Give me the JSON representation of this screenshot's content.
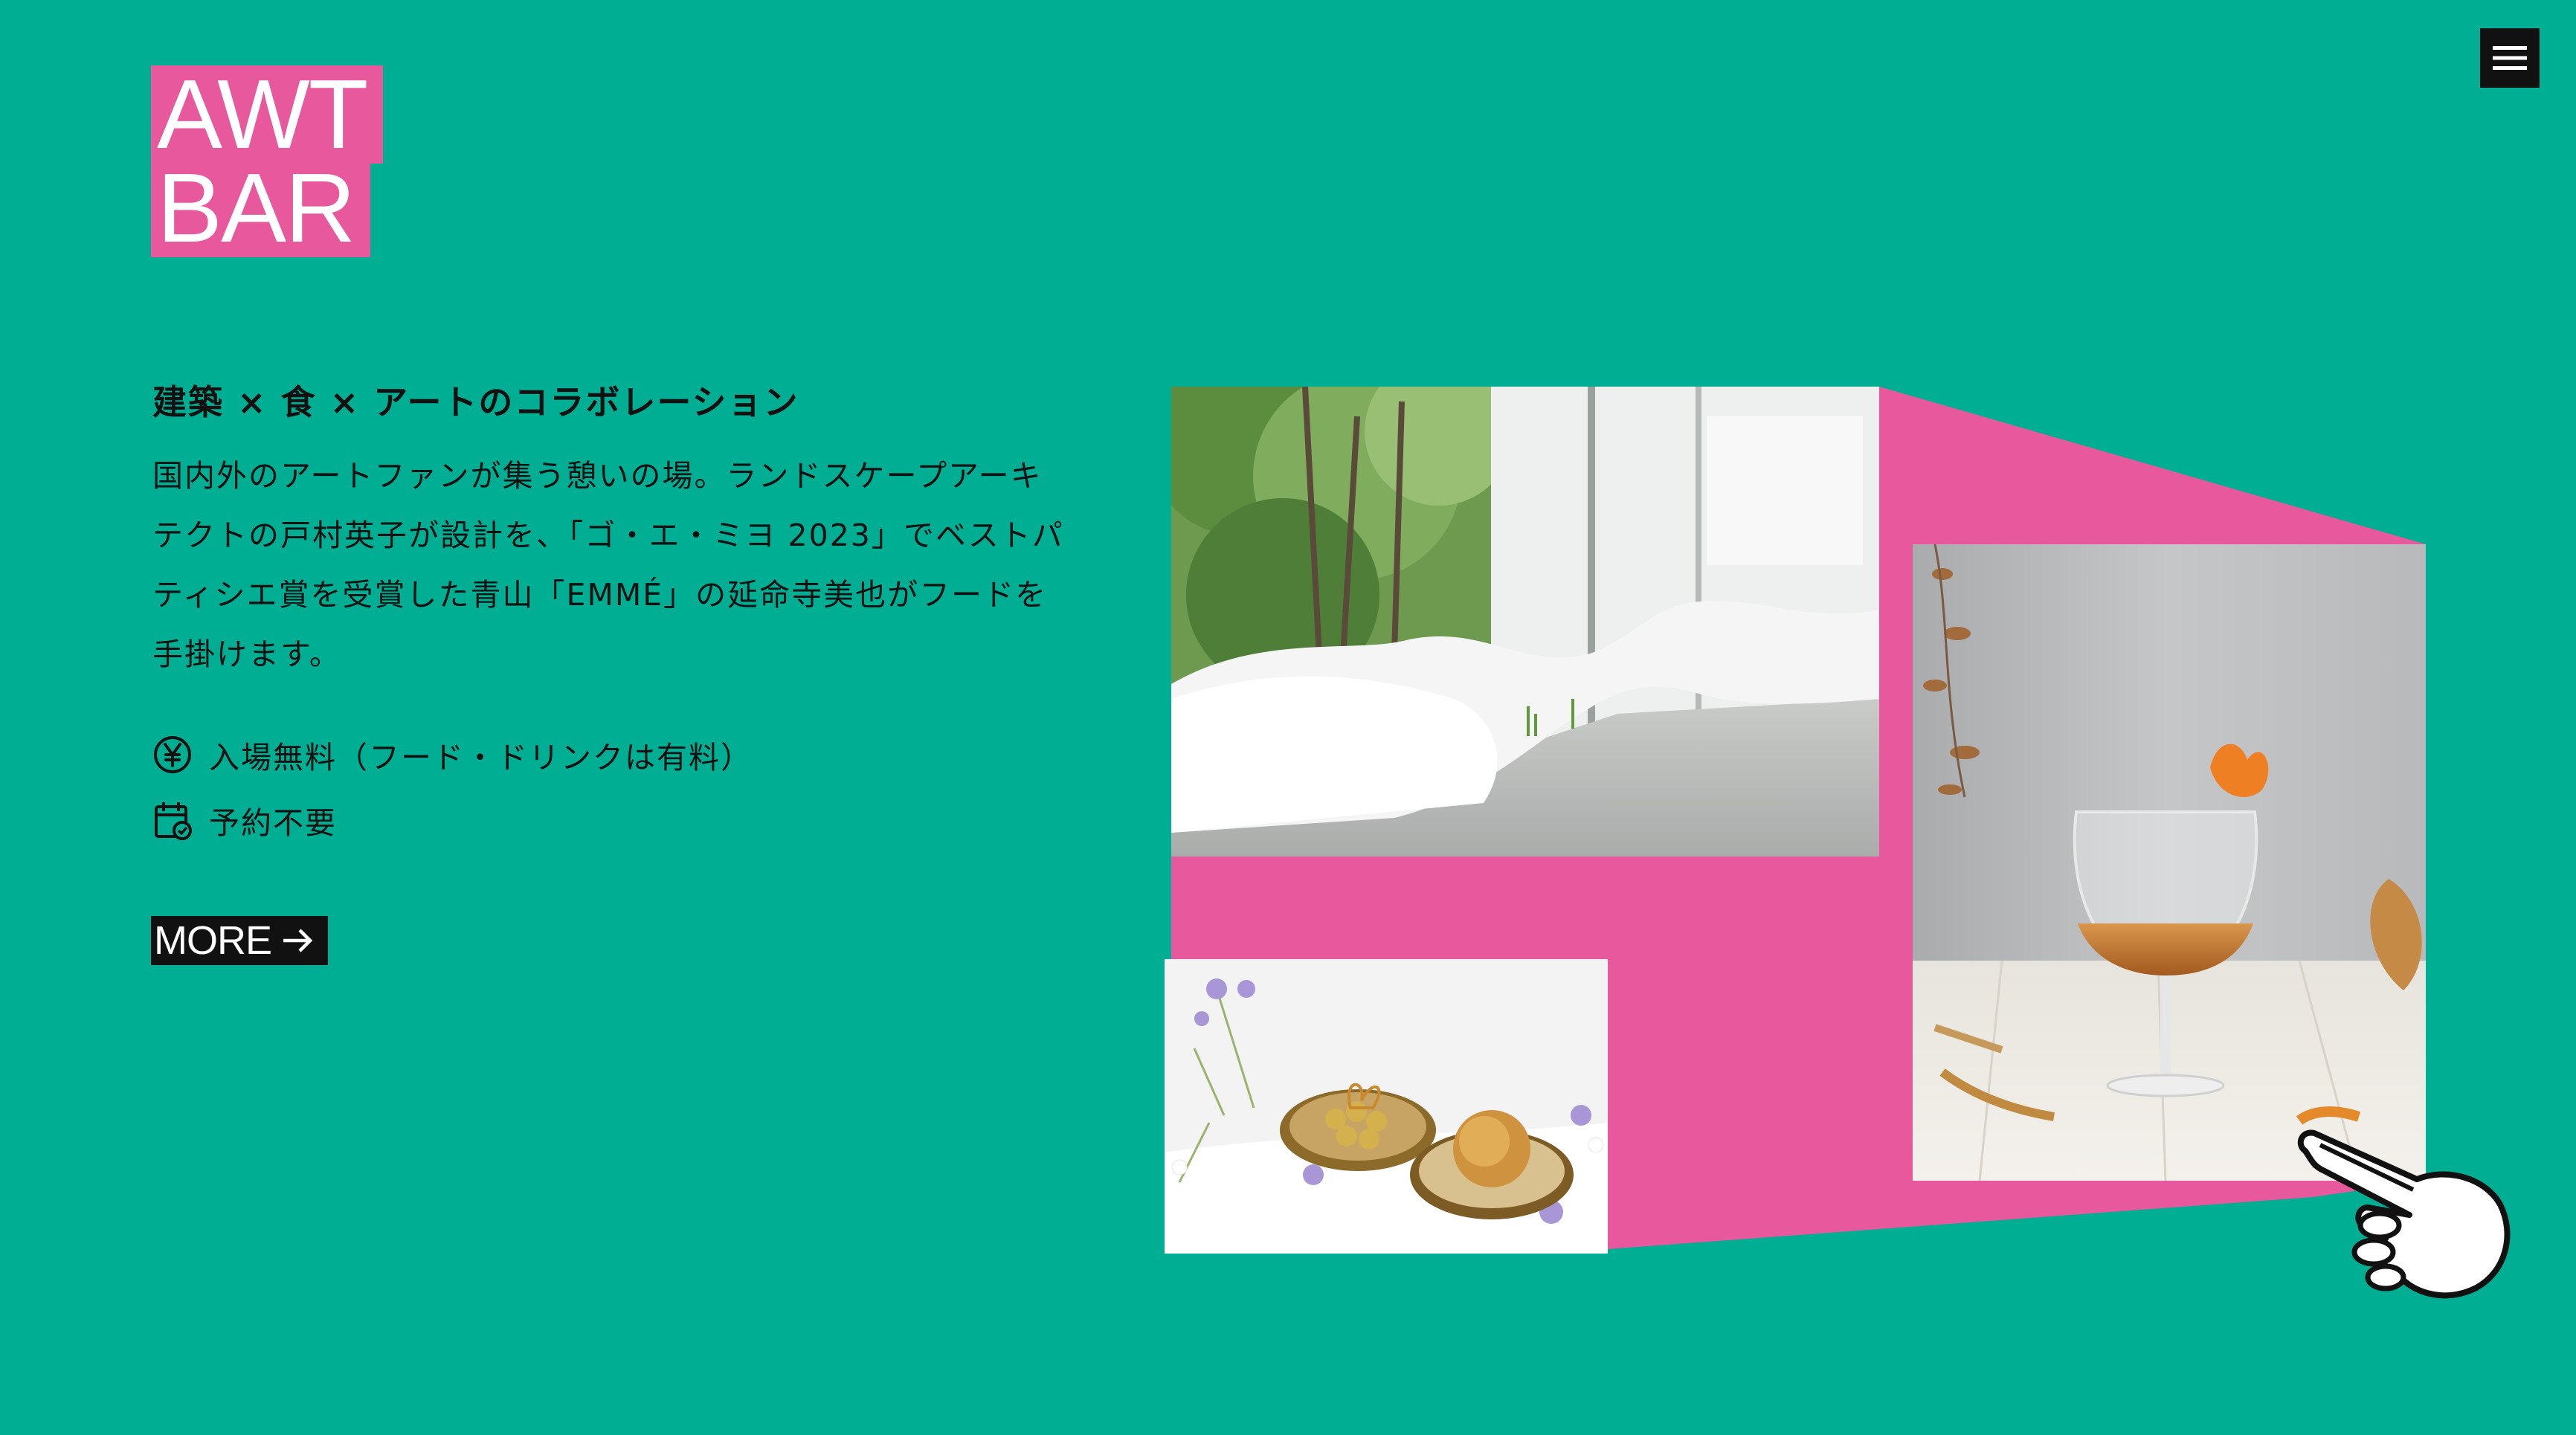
{
  "header": {
    "logo_line1": "AWT",
    "logo_line2": "BAR",
    "menu_icon": "hamburger-menu-icon"
  },
  "main": {
    "title": "建築 × 食 × アートのコラボレーション",
    "description": "国内外のアートファンが集う憩いの場。ランドスケープアーキテクトの戸村英子が設計を、「ゴ・エ・ミヨ 2023」でベストパティシエ賞を受賞した青山「EMMÉ」の延命寺美也がフードを手掛けます。",
    "info": [
      {
        "icon": "yen-icon",
        "text": "入場無料（フード・ドリンクは有料）"
      },
      {
        "icon": "calendar-check-icon",
        "text": "予約不要"
      }
    ],
    "more_label": "MORE",
    "more_icon": "arrow-right-icon"
  },
  "gallery": {
    "photos": [
      "interior-garden-photo",
      "cocktail-glass-photo",
      "sweets-plate-photo"
    ],
    "cursor_icon": "pointing-hand-icon"
  },
  "colors": {
    "background": "#00ae94",
    "accent_pink": "#e8589c",
    "text": "#111111",
    "button_bg": "#111111"
  }
}
